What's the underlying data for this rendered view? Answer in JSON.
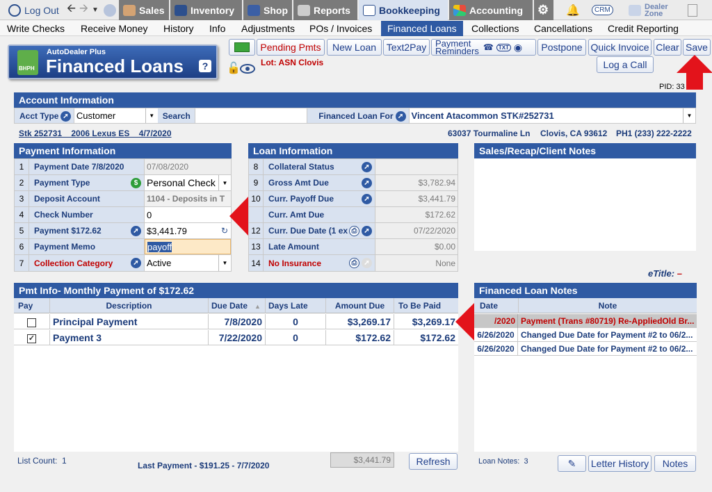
{
  "topnav": {
    "logout": "Log Out",
    "sales": "Sales",
    "inventory": "Inventory",
    "shop": "Shop",
    "reports": "Reports",
    "bookkeeping": "Bookkeeping",
    "accounting": "Accounting",
    "crm": "CRM",
    "dealer_zone_1": "Dealer",
    "dealer_zone_2": "Zone"
  },
  "menu": [
    "Write Checks",
    "Receive Money",
    "History",
    "Info",
    "Adjustments",
    "POs / Invoices",
    "Financed Loans",
    "Collections",
    "Cancellations",
    "Credit Reporting"
  ],
  "logo": {
    "brand": "AutoDealer Plus",
    "title": "Financed Loans",
    "badge": "BHPH",
    "help": "?"
  },
  "toolbar": {
    "pending": "Pending Pmts",
    "new_loan": "New Loan",
    "text2pay": "Text2Pay",
    "pay_rem_1": "Payment",
    "pay_rem_2": "Reminders",
    "txt": "TXT",
    "postpone": "Postpone",
    "quick_invoice": "Quick Invoice",
    "clear": "Clear",
    "save": "Save",
    "log_call": "Log a Call"
  },
  "lot": "Lot: ASN Clovis",
  "pid": "PID: 33",
  "account": {
    "header": "Account Information",
    "acct_type_label": "Acct Type",
    "acct_type": "Customer",
    "search_label": "Search",
    "search_value": "",
    "financed_for_label": "Financed Loan For",
    "financed_for": "Vincent Atacommon  STK#252731",
    "vehicle": "Stk 252731    2006 Lexus ES    4/7/2020",
    "address": "63037 Tourmaline Ln",
    "city": "Clovis, CA 93612",
    "phone": "PH1 (233) 222-2222"
  },
  "payment": {
    "header": "Payment Information",
    "rows": [
      {
        "n": "1",
        "label": "Payment Date  7/8/2020",
        "value": "07/08/2020"
      },
      {
        "n": "2",
        "label": "Payment Type",
        "value": "Personal Check"
      },
      {
        "n": "3",
        "label": "Deposit Account",
        "value": "1104 - Deposits in T"
      },
      {
        "n": "4",
        "label": "Check Number",
        "value": "0"
      },
      {
        "n": "5",
        "label": "Payment  $172.62",
        "value": "$3,441.79"
      },
      {
        "n": "6",
        "label": "Payment Memo",
        "value": "payoff"
      },
      {
        "n": "7",
        "label": "Collection Category",
        "value": "Active"
      }
    ]
  },
  "loan": {
    "header": "Loan Information",
    "rows": [
      {
        "n": "8",
        "label": "Collateral Status",
        "value": ""
      },
      {
        "n": "9",
        "label": "Gross Amt Due",
        "value": "$3,782.94"
      },
      {
        "n": "10",
        "label": "Curr. Payoff Due",
        "value": "$3,441.79"
      },
      {
        "n": "11",
        "label": "Curr. Amt Due",
        "value": "$172.62"
      },
      {
        "n": "12",
        "label": "Curr. Due Date (1 ex",
        "value": "07/22/2020"
      },
      {
        "n": "13",
        "label": "Late Amount",
        "value": "$0.00"
      },
      {
        "n": "14",
        "label": "No Insurance",
        "value": "None"
      }
    ]
  },
  "sales_notes": {
    "header": "Sales/Recap/Client Notes",
    "etitle_label": "eTitle:",
    "etitle_value": "–"
  },
  "pmt_info": {
    "header": "Pmt Info- Monthly Payment of $172.62",
    "columns": [
      "Pay",
      "Description",
      "Due Date",
      "Days Late",
      "Amount Due",
      "To Be Paid"
    ],
    "rows": [
      {
        "checked": false,
        "desc": "Principal Payment",
        "due": "7/8/2020",
        "late": "0",
        "amount": "$3,269.17",
        "tobepaid": "$3,269.17"
      },
      {
        "checked": true,
        "desc": "Payment 3",
        "due": "7/22/2020",
        "late": "0",
        "amount": "$172.62",
        "tobepaid": "$172.62"
      }
    ],
    "list_count_label": "List Count:",
    "list_count": "1",
    "last_payment": "Last Payment - $191.25 - 7/7/2020",
    "total": "$3,441.79",
    "refresh": "Refresh"
  },
  "loan_notes": {
    "header": "Financed Loan Notes",
    "columns": [
      "Date",
      "Note"
    ],
    "rows": [
      {
        "date": "/2020",
        "note": "Payment (Trans #80719) Re-AppliedOld Br..."
      },
      {
        "date": "6/26/2020",
        "note": "Changed Due Date for Payment #2 to 06/2..."
      },
      {
        "date": "6/26/2020",
        "note": "Changed Due Date for Payment #2 to 06/2..."
      }
    ],
    "count_label": "Loan Notes:",
    "count": "3",
    "letter_history": "Letter History",
    "notes": "Notes"
  },
  "colors": {
    "accent": "#2f5aa3",
    "header_bg": "#2f5aa3",
    "label_bg": "#d9e2f0",
    "alert": "#e3131b"
  }
}
